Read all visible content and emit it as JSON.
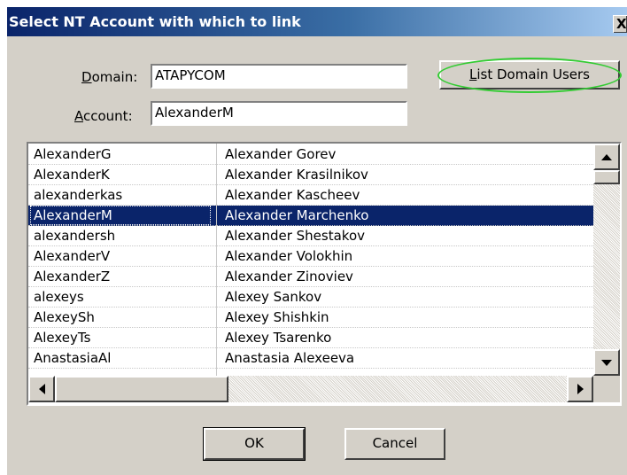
{
  "dialog": {
    "title": "Select NT Account with which to link",
    "close_glyph": "X"
  },
  "form": {
    "domain_label_mnemonic": "D",
    "domain_label_rest": "omain:",
    "domain_value": "ATAPYCOM",
    "account_label_mnemonic": "A",
    "account_label_rest": "ccount:",
    "account_value": "AlexanderM"
  },
  "buttons": {
    "list_users_mnemonic": "L",
    "list_users_rest": "ist Domain Users",
    "ok": "OK",
    "cancel": "Cancel"
  },
  "users": [
    {
      "account": "AlexanderG",
      "name": "Alexander Gorev"
    },
    {
      "account": "AlexanderK",
      "name": "Alexander Krasilnikov"
    },
    {
      "account": "alexanderkas",
      "name": "Alexander Kascheev"
    },
    {
      "account": "AlexanderM",
      "name": "Alexander Marchenko",
      "selected": true
    },
    {
      "account": "alexandersh",
      "name": "Alexander Shestakov"
    },
    {
      "account": "AlexanderV",
      "name": "Alexander Volokhin"
    },
    {
      "account": "AlexanderZ",
      "name": "Alexander Zinoviev"
    },
    {
      "account": "alexeys",
      "name": "Alexey Sankov"
    },
    {
      "account": "AlexeySh",
      "name": "Alexey Shishkin"
    },
    {
      "account": "AlexeyTs",
      "name": "Alexey Tsarenko"
    },
    {
      "account": "AnastasiaAl",
      "name": "Anastasia Alexeeva"
    }
  ],
  "colors": {
    "selection": "#0a246a",
    "highlight_ellipse": "#33cc33",
    "dialog_face": "#d4d0c8"
  }
}
